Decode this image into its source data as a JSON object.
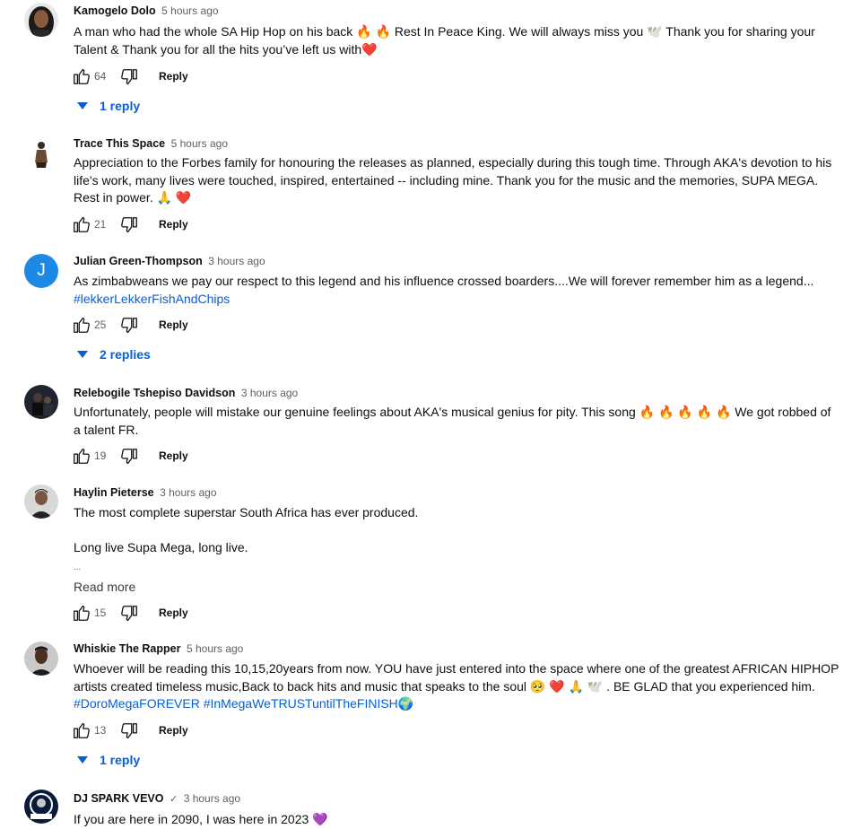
{
  "comments": [
    {
      "author": "Kamogelo Dolo",
      "time": "5 hours ago",
      "lines": [
        "A man who had the whole SA Hip Hop on his back 🔥 🔥  Rest In Peace King. We will always miss you 🕊️  Thank you for sharing your",
        "Talent  & Thank you for all the hits you’ve left us with❤️"
      ],
      "likes": "64",
      "reply_label": "Reply",
      "replies": "1 reply"
    },
    {
      "author": "Trace This Space",
      "time": "5 hours ago",
      "lines": [
        "Appreciation to the Forbes family for honouring the releases as planned, especially during this tough time. Through AKA's devotion to his",
        "life's work, many lives were touched, inspired, entertained -- including mine. Thank you for the music and the memories, SUPA MEGA.",
        "Rest in power. 🙏 ❤️"
      ],
      "likes": "21",
      "reply_label": "Reply"
    },
    {
      "author": "Julian Green-Thompson",
      "time": "3 hours ago",
      "avatar_letter": "J",
      "lines": [
        "As zimbabweans we pay our respect to this legend and his influence crossed boarders....We will forever remember him as a legend..."
      ],
      "hashtag": "#lekkerLekkerFishAndChips",
      "likes": "25",
      "reply_label": "Reply",
      "replies": "2 replies"
    },
    {
      "author": "Relebogile Tshepiso Davidson",
      "time": "3 hours ago",
      "lines": [
        "Unfortunately, people will mistake our genuine feelings about AKA's musical genius for pity. This song 🔥 🔥 🔥 🔥 🔥  We got robbed of",
        "a talent FR."
      ],
      "likes": "19",
      "reply_label": "Reply"
    },
    {
      "author": "Haylin Pieterse",
      "time": "3 hours ago",
      "lines": [
        "The most complete superstar South Africa has ever produced.",
        "Long live Supa Mega, long live."
      ],
      "ellipsis": "...",
      "read_more": "Read more",
      "likes": "15",
      "reply_label": "Reply"
    },
    {
      "author": "Whiskie The Rapper",
      "time": "5 hours ago",
      "lines": [
        "Whoever will be reading this 10,15,20years from now. YOU have just entered into the space where one of the greatest AFRICAN HIPHOP",
        "artists created timeless music,Back to back hits and music that speaks to the soul 🥺 ❤️ 🙏 🕊️ . BE GLAD that you experienced him."
      ],
      "hashtag": "#DoroMegaFOREVER #InMegaWeTRUSTuntilTheFINISH🌍",
      "likes": "13",
      "reply_label": "Reply",
      "replies": "1 reply"
    },
    {
      "author": "DJ SPARK VEVO",
      "verified": "✓",
      "time": "3 hours ago",
      "lines": [
        "If you are here in 2090, I was here in 2023 💜"
      ]
    }
  ],
  "colors": {
    "link_blue": "#065fd4",
    "meta_gray": "#606060",
    "avatar_blue": "#1e88e5",
    "heart_red": "#e0245e",
    "fire_orange": "#ff7a00"
  }
}
